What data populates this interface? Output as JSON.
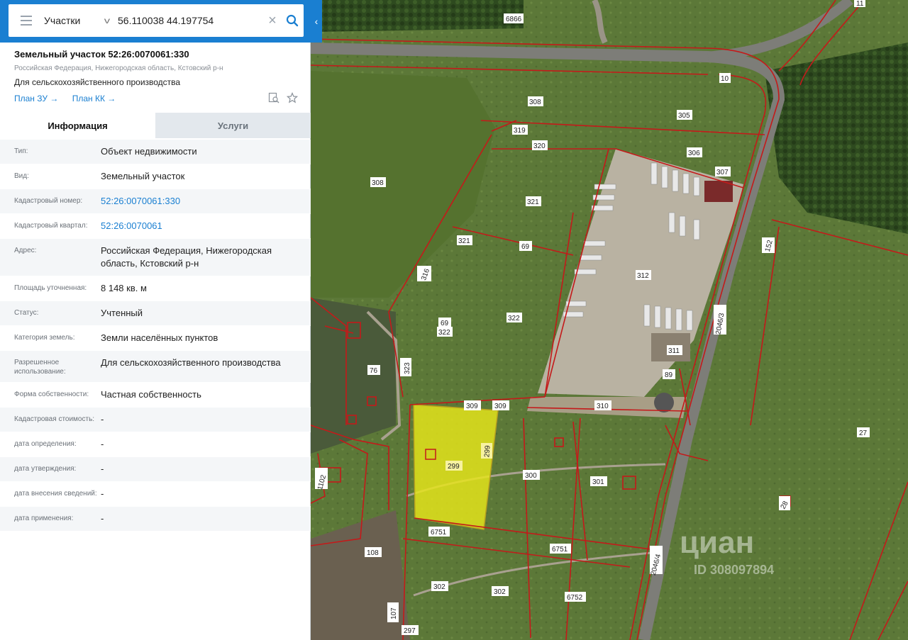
{
  "search": {
    "layer": "Участки",
    "query": "56.110038 44.197754"
  },
  "header": {
    "title": "Земельный участок 52:26:0070061:330",
    "address_line": "Российская Федерация, Нижегородская область, Кстовский р-н",
    "purpose": "Для сельскохозяйственного производства",
    "link_plan_zu": "План ЗУ →",
    "link_plan_kk": "План КК →"
  },
  "tabs": {
    "info": "Информация",
    "services": "Услуги"
  },
  "info_rows": [
    {
      "label": "Тип:",
      "value": "Объект недвижимости"
    },
    {
      "label": "Вид:",
      "value": "Земельный участок"
    },
    {
      "label": "Кадастровый номер:",
      "value": "52:26:0070061:330"
    },
    {
      "label": "Кадастровый квартал:",
      "value": "52:26:0070061"
    },
    {
      "label": "Адрес:",
      "value": "Российская Федерация, Нижегородская область, Кстовский р-н"
    },
    {
      "label": "Площадь уточненная:",
      "value": "8 148 кв. м"
    },
    {
      "label": "Статус:",
      "value": "Учтенный"
    },
    {
      "label": "Категория земель:",
      "value": "Земли населённых пунктов"
    },
    {
      "label": "Разрешенное использование:",
      "value": "Для сельскохозяйственного производства"
    },
    {
      "label": "Форма собственности:",
      "value": "Частная собственность"
    },
    {
      "label": "Кадастровая стоимость:",
      "value": "-"
    },
    {
      "label": "дата определения:",
      "value": "-"
    },
    {
      "label": "дата утверждения:",
      "value": "-"
    },
    {
      "label": "дата внесения сведений:",
      "value": "-"
    },
    {
      "label": "дата применения:",
      "value": "-"
    }
  ],
  "map": {
    "parcel_labels": [
      "6866",
      "10",
      "308",
      "305",
      "319",
      "320",
      "306",
      "307",
      "308",
      "321",
      "321",
      "69",
      "316",
      "312",
      "152",
      "69",
      "322",
      "322",
      "2046/3",
      "311",
      "89",
      "76",
      "323",
      "309",
      "309",
      "310",
      "299",
      "299",
      "300",
      "301",
      "27",
      "1102",
      "28",
      "6751",
      "6751",
      "108",
      "302",
      "302",
      "6752",
      "2046/4",
      "107",
      "297",
      "11"
    ],
    "watermark": "циан",
    "watermark_id": "ID 308097894",
    "colors": {
      "boundary": "#c41a1a",
      "selected_fill": "#e8e61a",
      "field": "#5f7a3a",
      "forest": "#2f4a20",
      "road": "#8a8a84"
    }
  }
}
